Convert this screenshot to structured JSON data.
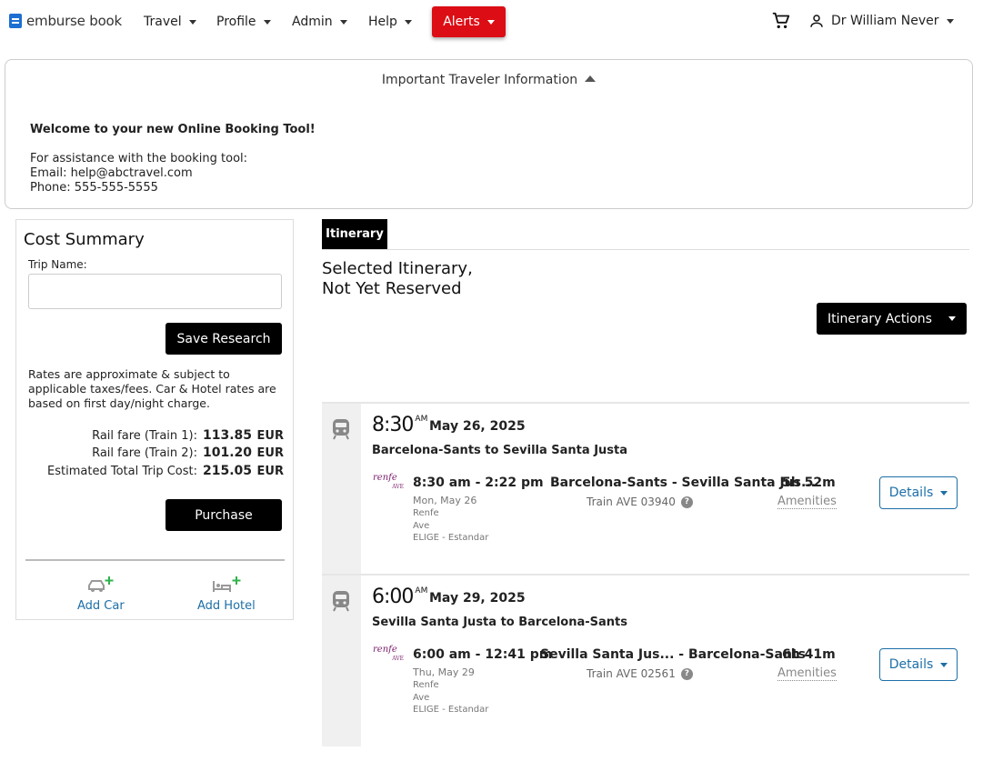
{
  "nav": {
    "logo": "emburse book",
    "items": [
      "Travel",
      "Profile",
      "Admin",
      "Help"
    ],
    "alerts": "Alerts",
    "user": "Dr William Never"
  },
  "info": {
    "toggle": "Important Traveler Information",
    "welcome": "Welcome to your new Online Booking Tool!",
    "assist": "For assistance with the booking tool:",
    "email": "Email:  help@abctravel.com",
    "phone": "Phone:  555-555-5555"
  },
  "cost": {
    "title": "Cost Summary",
    "trip_label": "Trip Name:",
    "trip_value": "",
    "save": "Save Research",
    "note": "Rates are approximate & subject to applicable taxes/fees. Car & Hotel rates are based on first day/night charge.",
    "fares": [
      {
        "label": "Rail fare (Train 1):",
        "value": "113.85",
        "currency": "EUR"
      },
      {
        "label": "Rail fare (Train 2):",
        "value": "101.20",
        "currency": "EUR"
      },
      {
        "label": "Estimated Total Trip Cost:",
        "value": "215.05",
        "currency": "EUR"
      }
    ],
    "purchase": "Purchase",
    "add_car": "Add Car",
    "add_hotel": "Add Hotel"
  },
  "itinerary": {
    "tab": "Itinerary",
    "title1": "Selected Itinerary,",
    "title2": "Not Yet Reserved",
    "actions": "Itinerary Actions",
    "segments": [
      {
        "dep_time": "8:30",
        "ampm": "AM",
        "date": "May 26, 2025",
        "route": "Barcelona-Sants to Sevilla Santa Justa",
        "carrier_logo": "renfe",
        "carrier_sub": "AVE",
        "times": "8:30 am - 2:22 pm",
        "day": "Mon, May 26",
        "carrier": "Renfe",
        "class": "Ave",
        "fare": "ELIGE - Estandar",
        "stations": "Barcelona-Sants  -  Sevilla Santa Jus...",
        "train": "Train AVE 03940",
        "duration": "5h 52m",
        "amenities": "Amenities",
        "details": "Details"
      },
      {
        "dep_time": "6:00",
        "ampm": "AM",
        "date": "May 29, 2025",
        "route": "Sevilla Santa Justa to Barcelona-Sants",
        "carrier_logo": "renfe",
        "carrier_sub": "AVE",
        "times": "6:00 am - 12:41 pm",
        "day": "Thu, May 29",
        "carrier": "Renfe",
        "class": "Ave",
        "fare": "ELIGE - Estandar",
        "stations": "Sevilla Santa Jus...  -  Barcelona-Sants",
        "train": "Train AVE 02561",
        "duration": "6h 41m",
        "amenities": "Amenities",
        "details": "Details"
      }
    ]
  }
}
